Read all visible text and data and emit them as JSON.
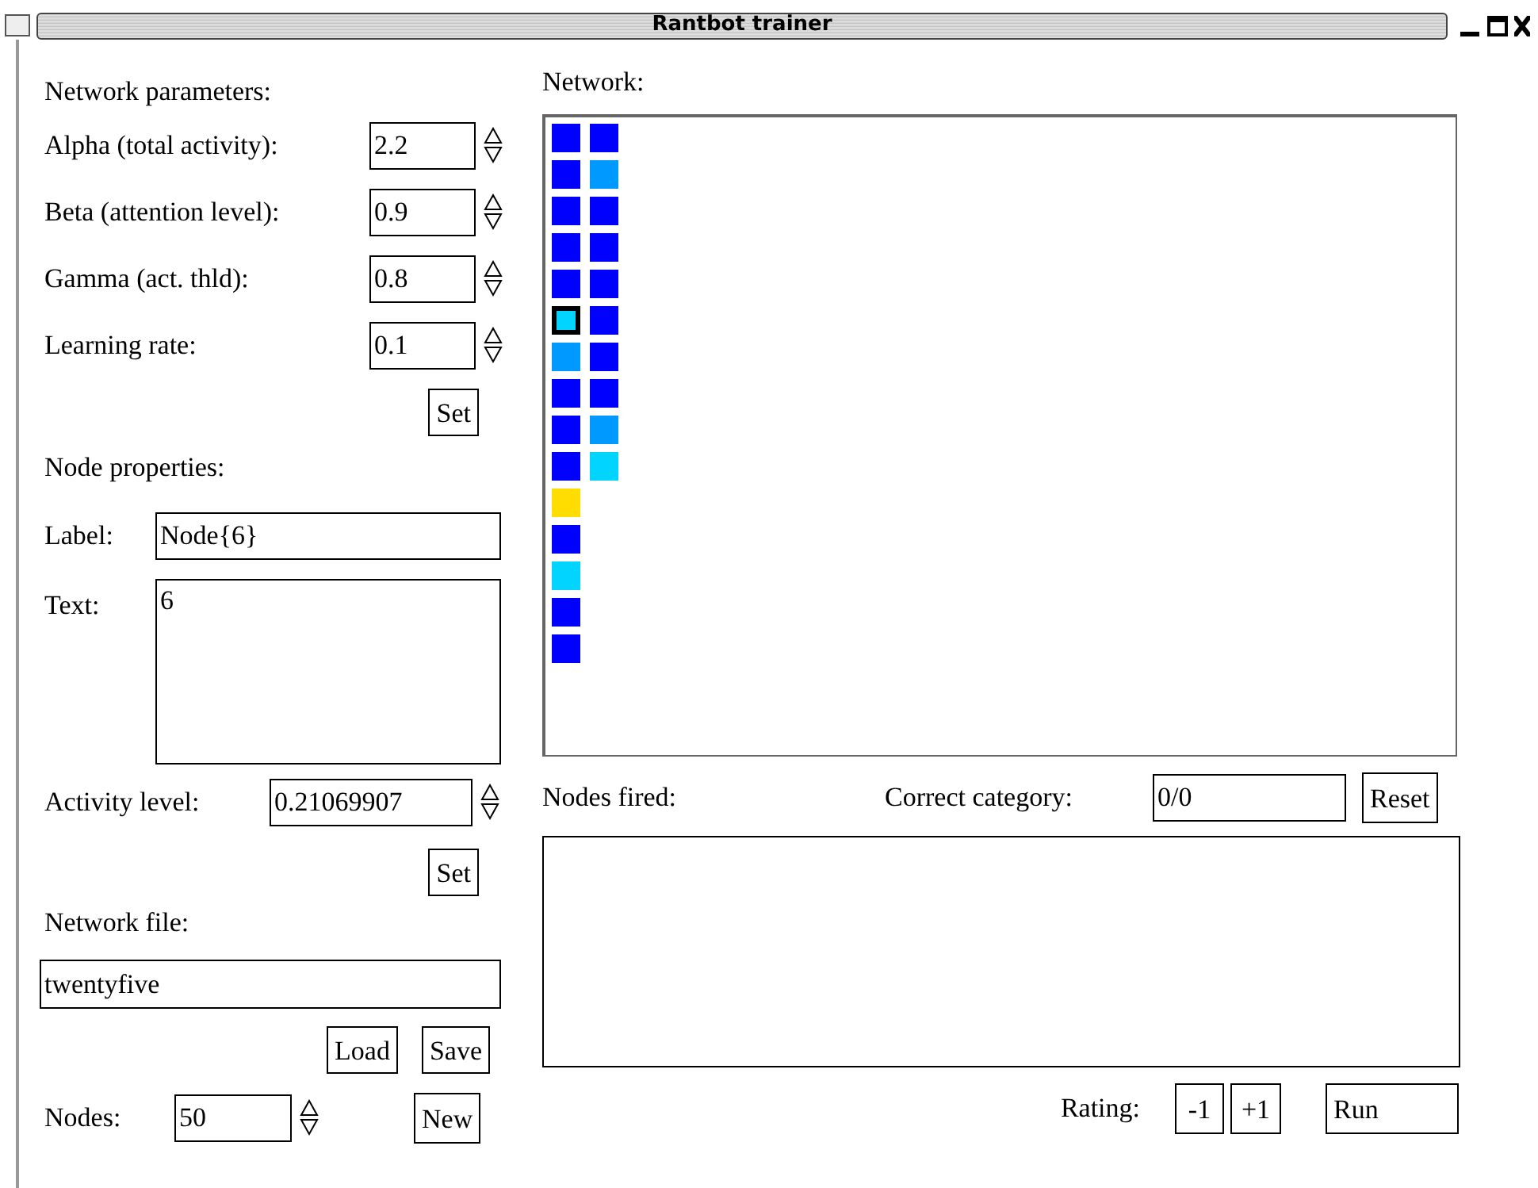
{
  "window": {
    "title": "Rantbot trainer"
  },
  "network_parameters": {
    "heading": "Network parameters:",
    "params": [
      {
        "label": "Alpha (total activity):",
        "value": "2.2"
      },
      {
        "label": "Beta (attention level):",
        "value": "0.9"
      },
      {
        "label": "Gamma (act. thld):",
        "value": "0.8"
      },
      {
        "label": "Learning rate:",
        "value": "0.1"
      }
    ],
    "set_button": "Set"
  },
  "node_properties": {
    "heading": "Node properties:",
    "label_label": "Label:",
    "label_value": "Node{6}",
    "text_label": "Text:",
    "text_value": "6",
    "activity_label": "Activity level:",
    "activity_value": "0.21069907",
    "set_button": "Set"
  },
  "network_file": {
    "heading": "Network file:",
    "value": "twentyfive",
    "load_button": "Load",
    "save_button": "Save",
    "nodes_label": "Nodes:",
    "nodes_value": "50",
    "new_button": "New"
  },
  "network": {
    "heading": "Network:",
    "columns": [
      [
        {
          "color": "#0000ff",
          "selected": false
        },
        {
          "color": "#0000ff",
          "selected": false
        },
        {
          "color": "#0000ff",
          "selected": false
        },
        {
          "color": "#0000ff",
          "selected": false
        },
        {
          "color": "#0000ff",
          "selected": false
        },
        {
          "color": "#00d4ff",
          "selected": true
        },
        {
          "color": "#0099ff",
          "selected": false
        },
        {
          "color": "#0000ff",
          "selected": false
        },
        {
          "color": "#0000ff",
          "selected": false
        },
        {
          "color": "#0000ff",
          "selected": false
        },
        {
          "color": "#ffdd00",
          "selected": false
        },
        {
          "color": "#0000ff",
          "selected": false
        },
        {
          "color": "#00d4ff",
          "selected": false
        },
        {
          "color": "#0000ff",
          "selected": false
        },
        {
          "color": "#0000ff",
          "selected": false
        }
      ],
      [
        {
          "color": "#0000ff",
          "selected": false
        },
        {
          "color": "#0099ff",
          "selected": false
        },
        {
          "color": "#0000ff",
          "selected": false
        },
        {
          "color": "#0000ff",
          "selected": false
        },
        {
          "color": "#0000ff",
          "selected": false
        },
        {
          "color": "#0000ff",
          "selected": false
        },
        {
          "color": "#0000ff",
          "selected": false
        },
        {
          "color": "#0000ff",
          "selected": false
        },
        {
          "color": "#0099ff",
          "selected": false
        },
        {
          "color": "#00d4ff",
          "selected": false
        }
      ]
    ]
  },
  "nodes_fired": {
    "label": "Nodes fired:",
    "correct_label": "Correct category:",
    "correct_value": "0/0",
    "reset_button": "Reset"
  },
  "rating": {
    "label": "Rating:",
    "minus_button": "-1",
    "plus_button": "+1",
    "run_button": "Run"
  }
}
